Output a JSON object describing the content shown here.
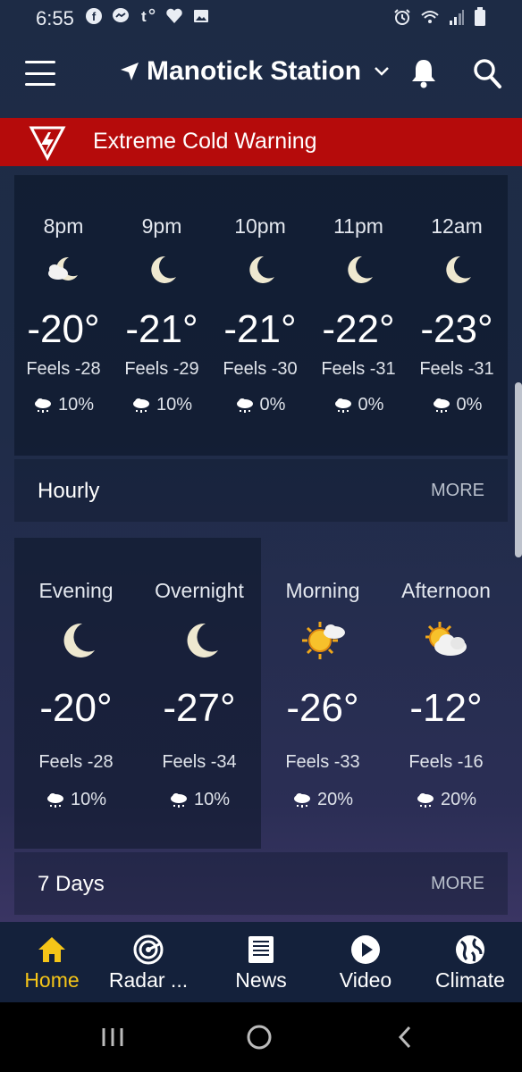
{
  "status_bar": {
    "time": "6:55",
    "left_icons": [
      "facebook-icon",
      "messenger-icon",
      "tumblr-icon",
      "heart-icon",
      "gallery-icon"
    ],
    "right_icons": [
      "alarm-icon",
      "wifi-icon",
      "signal-icon",
      "battery-icon"
    ]
  },
  "header": {
    "location": "Manotick Station",
    "icons": [
      "menu-icon",
      "location-arrow-icon",
      "chevron-down-icon",
      "bell-icon",
      "search-icon"
    ]
  },
  "warning": {
    "text": "Extreme Cold Warning",
    "color": "#b50b0b"
  },
  "hourly": {
    "items": [
      {
        "time": "8pm",
        "icon": "partly-cloudy-night-icon",
        "temp": "-20°",
        "feels": "Feels -28",
        "pop": "10%"
      },
      {
        "time": "9pm",
        "icon": "moon-icon",
        "temp": "-21°",
        "feels": "Feels -29",
        "pop": "10%"
      },
      {
        "time": "10pm",
        "icon": "moon-icon",
        "temp": "-21°",
        "feels": "Feels -30",
        "pop": "0%"
      },
      {
        "time": "11pm",
        "icon": "moon-icon",
        "temp": "-22°",
        "feels": "Feels -31",
        "pop": "0%"
      },
      {
        "time": "12am",
        "icon": "moon-icon",
        "temp": "-23°",
        "feels": "Feels -31",
        "pop": "0%"
      }
    ],
    "section_title": "Hourly",
    "more_label": "MORE"
  },
  "periods": {
    "items": [
      {
        "label": "Evening",
        "icon": "moon-icon",
        "temp": "-20°",
        "feels": "Feels -28",
        "pop": "10%"
      },
      {
        "label": "Overnight",
        "icon": "moon-icon",
        "temp": "-27°",
        "feels": "Feels -34",
        "pop": "10%"
      },
      {
        "label": "Morning",
        "icon": "sun-cloud-icon",
        "temp": "-26°",
        "feels": "Feels -33",
        "pop": "20%"
      },
      {
        "label": "Afternoon",
        "icon": "sun-cloud-icon",
        "temp": "-12°",
        "feels": "Feels -16",
        "pop": "20%"
      }
    ],
    "section_title": "7 Days",
    "more_label": "MORE"
  },
  "bottom_nav": {
    "items": [
      {
        "label": "Home",
        "icon": "home-icon"
      },
      {
        "label": "Radar ...",
        "icon": "radar-icon"
      },
      {
        "label": "News",
        "icon": "news-icon"
      },
      {
        "label": "Video",
        "icon": "play-icon"
      },
      {
        "label": "Climate",
        "icon": "globe-icon"
      }
    ],
    "active_color": "#f5c518"
  },
  "system_nav": {
    "icons": [
      "recents-icon",
      "home-circle-icon",
      "back-icon"
    ]
  }
}
